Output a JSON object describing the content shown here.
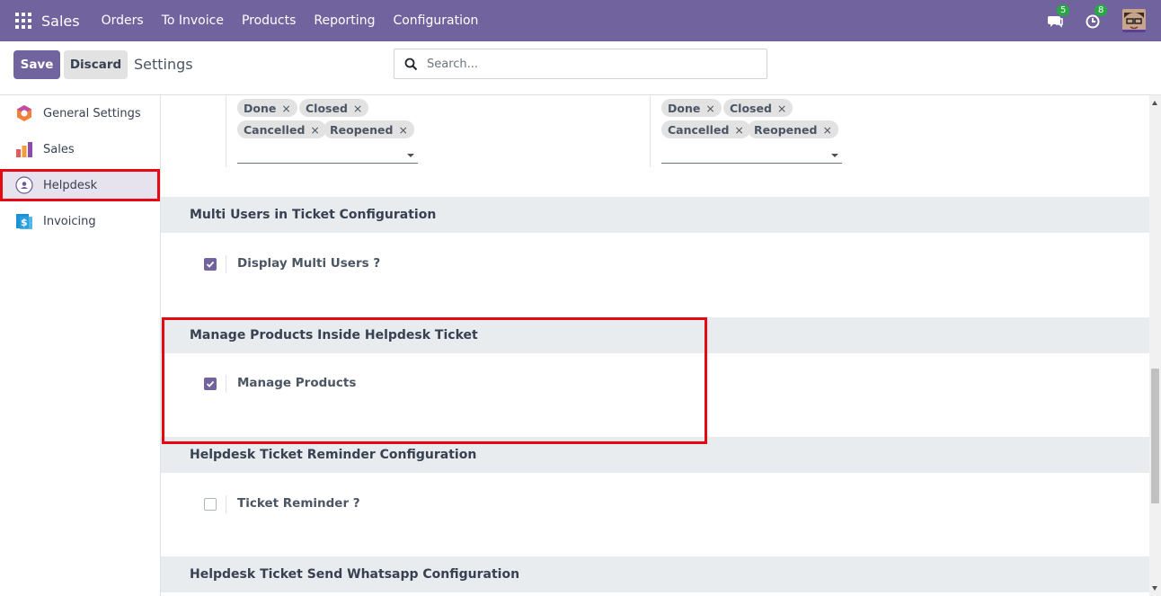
{
  "navbar": {
    "app_name": "Sales",
    "menu": [
      "Orders",
      "To Invoice",
      "Products",
      "Reporting",
      "Configuration"
    ],
    "messages_count": "5",
    "activities_count": "8",
    "badge_color": "#28a745",
    "brand_color": "#71639e"
  },
  "control_panel": {
    "save_label": "Save",
    "discard_label": "Discard",
    "title": "Settings",
    "search_placeholder": "Search..."
  },
  "sidebar": {
    "items": [
      {
        "label": "General Settings",
        "icon": "general-settings-icon"
      },
      {
        "label": "Sales",
        "icon": "sales-chart-icon"
      },
      {
        "label": "Helpdesk",
        "icon": "helpdesk-icon",
        "active": true
      },
      {
        "label": "Invoicing",
        "icon": "invoicing-icon"
      }
    ]
  },
  "stage_fields": {
    "left_tags": [
      "Done",
      "Closed",
      "Cancelled",
      "Reopened"
    ],
    "right_tags": [
      "Done",
      "Closed",
      "Cancelled",
      "Reopened"
    ],
    "remove_glyph": "×"
  },
  "sections": {
    "multi_users": {
      "title": "Multi Users in Ticket Configuration",
      "setting_label": "Display Multi Users ?",
      "checked": true
    },
    "manage_products": {
      "title": "Manage Products Inside Helpdesk Ticket",
      "setting_label": "Manage Products",
      "checked": true
    },
    "reminder": {
      "title": "Helpdesk Ticket Reminder Configuration",
      "setting_label": "Ticket Reminder ?",
      "checked": false
    },
    "whatsapp": {
      "title": "Helpdesk Ticket Send Whatsapp Configuration"
    }
  },
  "annotation_color": "#e50914"
}
